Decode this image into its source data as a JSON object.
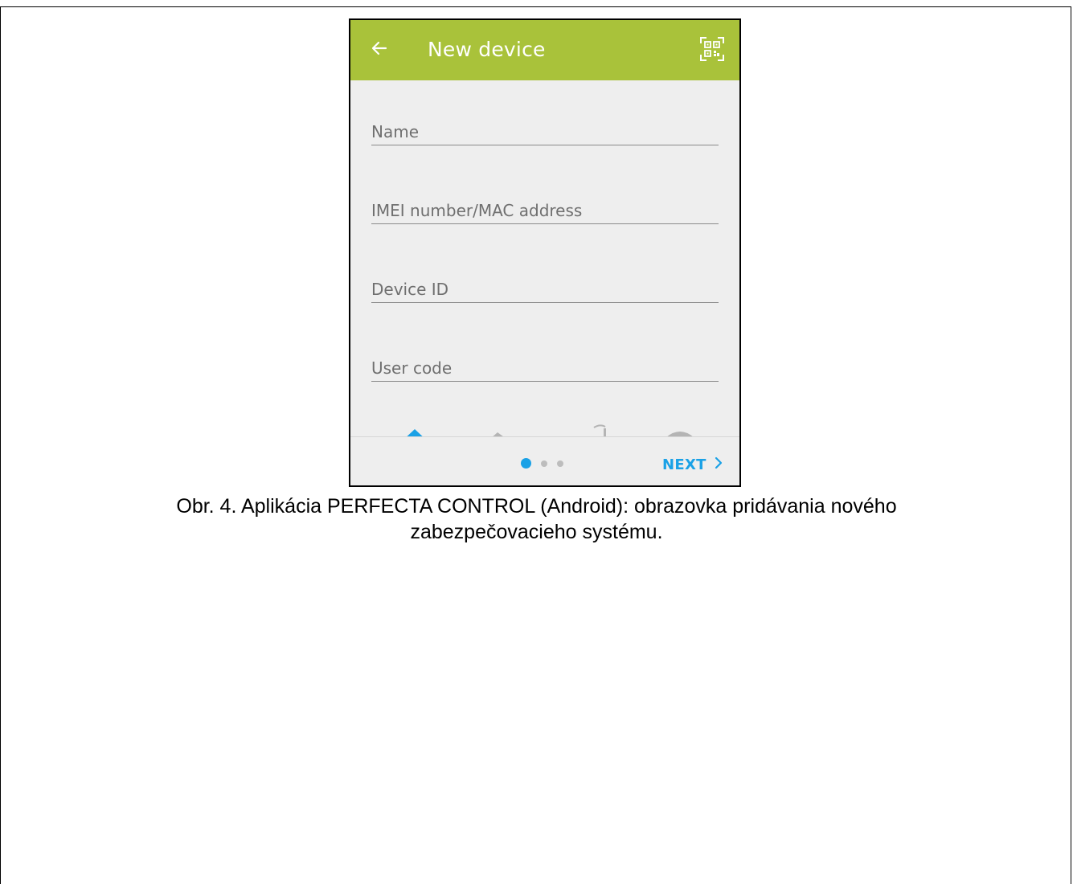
{
  "appbar": {
    "title": "New device",
    "back_icon": "arrow-left-icon",
    "qr_icon": "qr-code-scan-icon"
  },
  "form": {
    "fields": [
      {
        "placeholder": "Name",
        "value": ""
      },
      {
        "placeholder": "IMEI number/MAC address",
        "value": ""
      },
      {
        "placeholder": "Device ID",
        "value": ""
      },
      {
        "placeholder": "User code",
        "value": ""
      }
    ]
  },
  "object_types": [
    {
      "icon": "house-icon",
      "selected": true
    },
    {
      "icon": "lake-house-icon",
      "selected": false
    },
    {
      "icon": "factory-icon",
      "selected": false
    },
    {
      "icon": "garage-icon",
      "selected": false
    }
  ],
  "pager": {
    "total_pages": 3,
    "current_page": 1,
    "next_label": "NEXT"
  },
  "caption": {
    "line1": "Obr. 4. Aplikácia PERFECTA CONTROL (Android): obrazovka pridávania nového",
    "line2": "zabezpečovacieho systému."
  },
  "colors": {
    "appbar": "#a9c23a",
    "accent": "#1aa1e6",
    "inactive_icon": "#b4b4b4",
    "background": "#eeeeee"
  }
}
